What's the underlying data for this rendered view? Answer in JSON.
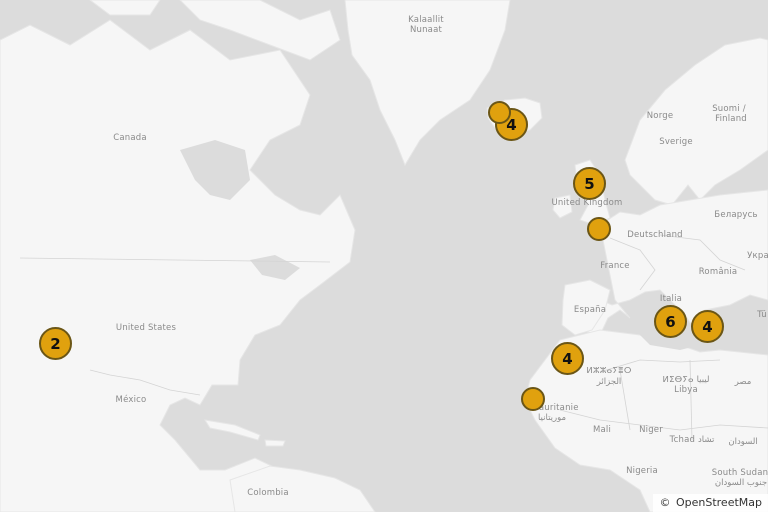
{
  "map": {
    "colors": {
      "water": "#dcdcdc",
      "land": "#f6f6f6",
      "border": "#cfcfcf",
      "marker_fill": "#e0a10e",
      "marker_stroke": "#6b5616"
    },
    "labels": {
      "kalaallit": "Kalaallit",
      "nunaat": "Nunaat",
      "canada": "Canada",
      "united_states": "United States",
      "mexico": "México",
      "colombia": "Colombia",
      "norge": "Norge",
      "sverige": "Sverige",
      "suomi": "Suomi /",
      "finland": "Finland",
      "uk": "United Kingdom",
      "deutschland": "Deutschland",
      "belarus": "Беларусь",
      "ukr": "Укра",
      "france": "France",
      "romania": "România",
      "espana": "España",
      "italia": "Italia",
      "tu": "Tü",
      "dz_tif": "ⵍⵣⵣⴰⵢⴻⵔ",
      "dz_ar": "الجزائر",
      "ly_tif": "ⵍⵉⴱⵢⴰ ليبيا",
      "libya": "Libya",
      "misr": "مصر",
      "mauritanie": "Mauritanie",
      "mr_ar": "موريتانيا",
      "mali": "Mali",
      "niger": "Niger",
      "tchad": "Tchad تشاد",
      "sudan_ar": "السودان",
      "nigeria": "Nigeria",
      "south_sudan": "South Sudan",
      "ss_ar": "جنوب السودان"
    },
    "clusters": [
      {
        "count": "4",
        "region": "iceland"
      },
      {
        "count": "",
        "region": "iceland-west"
      },
      {
        "count": "5",
        "region": "united-kingdom"
      },
      {
        "count": "",
        "region": "belgium"
      },
      {
        "count": "2",
        "region": "california"
      },
      {
        "count": "4",
        "region": "morocco"
      },
      {
        "count": "",
        "region": "mauritania"
      },
      {
        "count": "6",
        "region": "italy"
      },
      {
        "count": "4",
        "region": "greece"
      }
    ],
    "attribution": {
      "symbol": "©",
      "text": "OpenStreetMap"
    }
  }
}
